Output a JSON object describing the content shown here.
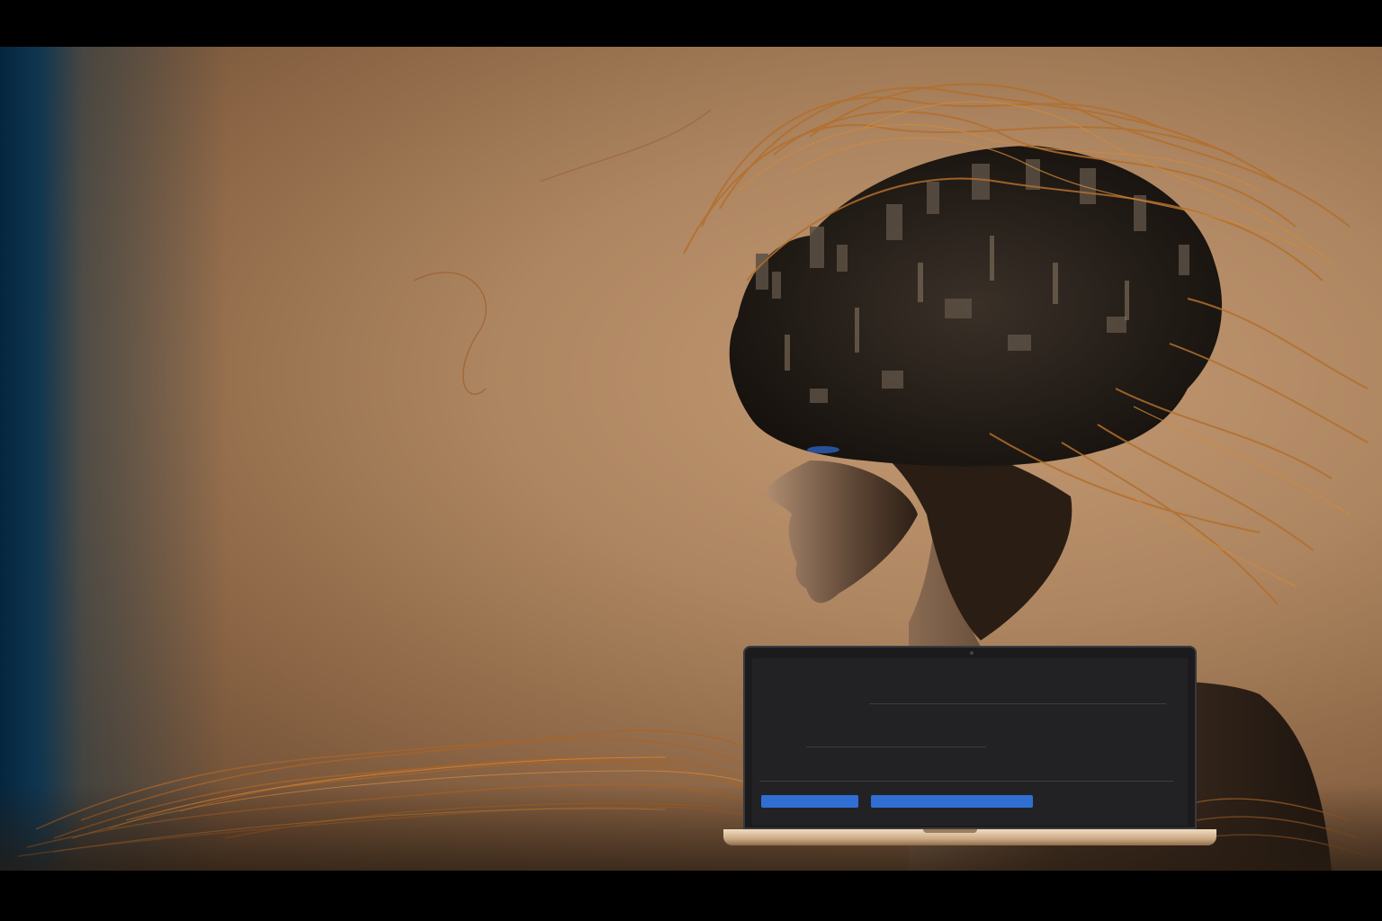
{
  "image": {
    "kind": "photo-illustration",
    "palette": {
      "background_warm": "#ad8560",
      "background_cool": "#06263d",
      "wire": "#b36f2c",
      "bust": "#3b2a1e",
      "screen_bg": "#222225",
      "button_blue": "#2f6fd4"
    }
  },
  "laptop_screen": {
    "title": "",
    "lines": [
      "",
      "",
      "",
      "",
      ""
    ],
    "buttons": [
      "",
      ""
    ]
  }
}
